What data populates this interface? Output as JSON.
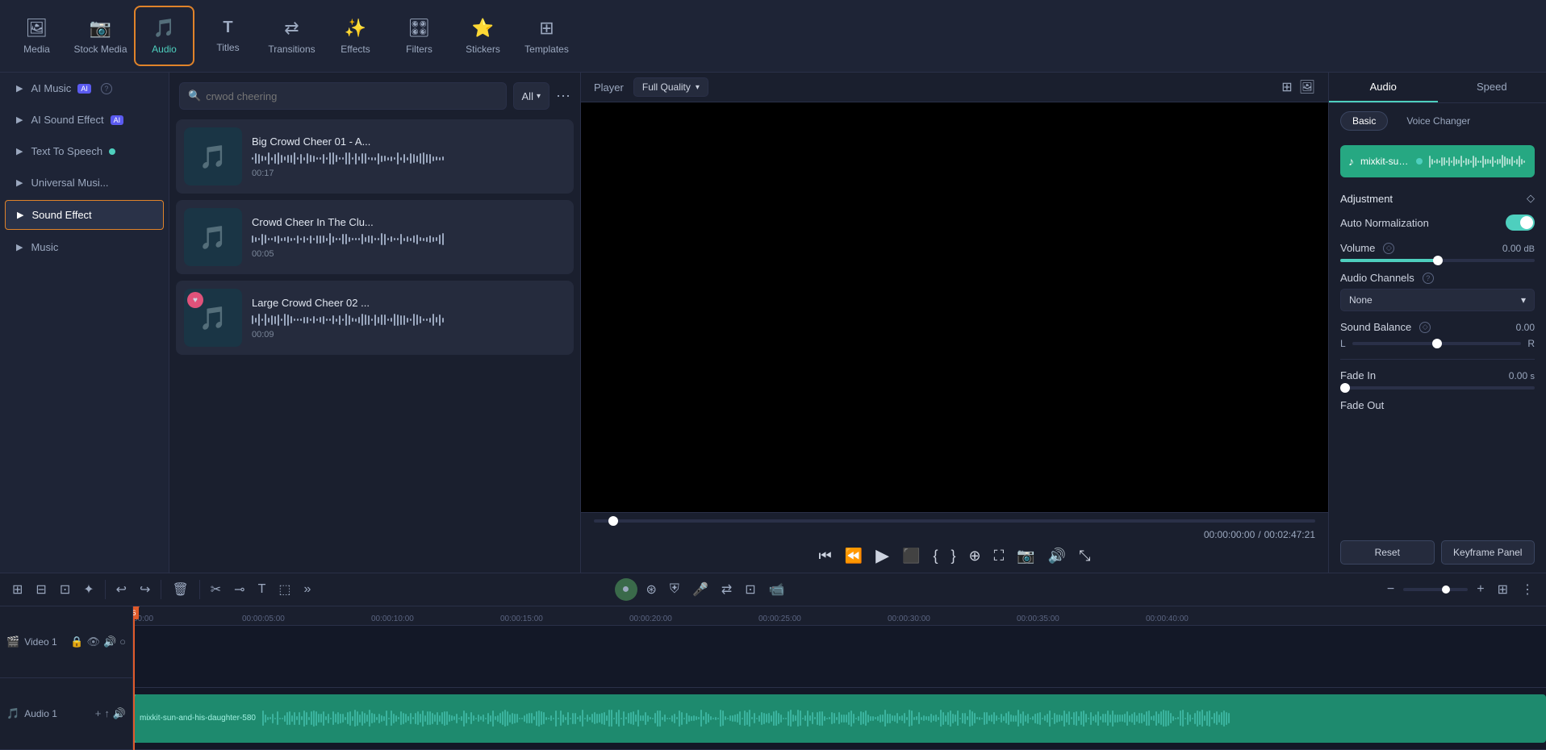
{
  "toolbar": {
    "items": [
      {
        "id": "media",
        "label": "Media",
        "icon": "🖼",
        "active": false
      },
      {
        "id": "stock-media",
        "label": "Stock Media",
        "icon": "📷",
        "active": false
      },
      {
        "id": "audio",
        "label": "Audio",
        "icon": "🎵",
        "active": true
      },
      {
        "id": "titles",
        "label": "Titles",
        "icon": "T",
        "active": false
      },
      {
        "id": "transitions",
        "label": "Transitions",
        "icon": "↔",
        "active": false
      },
      {
        "id": "effects",
        "label": "Effects",
        "icon": "✨",
        "active": false
      },
      {
        "id": "filters",
        "label": "Filters",
        "icon": "🎛",
        "active": false
      },
      {
        "id": "stickers",
        "label": "Stickers",
        "icon": "⭐",
        "active": false
      },
      {
        "id": "templates",
        "label": "Templates",
        "icon": "⊞",
        "active": false
      }
    ]
  },
  "left_panel": {
    "items": [
      {
        "id": "ai-music",
        "label": "AI Music",
        "has_ai_badge": true,
        "has_info": true
      },
      {
        "id": "ai-sound-effect",
        "label": "AI Sound Effect",
        "has_ai_badge": true
      },
      {
        "id": "text-to-speech",
        "label": "Text To Speech",
        "has_dot_badge": true
      },
      {
        "id": "universal-music",
        "label": "Universal Musi...",
        "has_nothing": true
      },
      {
        "id": "sound-effect",
        "label": "Sound Effect",
        "selected": true
      },
      {
        "id": "music",
        "label": "Music"
      }
    ]
  },
  "search": {
    "placeholder": "crwod cheering",
    "filter_label": "All"
  },
  "results": [
    {
      "id": "result-1",
      "title": "Big Crowd Cheer 01 - A...",
      "duration": "00:17",
      "thumb_color": "#1a3545"
    },
    {
      "id": "result-2",
      "title": "Crowd Cheer In The Clu...",
      "duration": "00:05",
      "thumb_color": "#1a3545"
    },
    {
      "id": "result-3",
      "title": "Large Crowd Cheer 02 ...",
      "duration": "00:09",
      "thumb_color": "#1a3545",
      "has_heart": true
    }
  ],
  "player": {
    "label": "Player",
    "quality": "Full Quality",
    "time_current": "00:00:00:00",
    "time_total": "00:02:47:21"
  },
  "right_panel": {
    "tabs": [
      "Audio",
      "Speed"
    ],
    "active_tab": "Audio",
    "sub_tabs": [
      "Basic",
      "Voice Changer"
    ],
    "active_sub_tab": "Basic",
    "audio_track_name": "mixkit-sun-and-his-d...",
    "adjustment_label": "Adjustment",
    "auto_normalization_label": "Auto Normalization",
    "auto_normalization_on": true,
    "volume_label": "Volume",
    "volume_value": "0.00",
    "volume_unit": "dB",
    "audio_channels_label": "Audio Channels",
    "channels_value": "None",
    "sound_balance_label": "Sound Balance",
    "balance_l": "L",
    "balance_r": "R",
    "balance_value": "0.00",
    "fade_in_label": "Fade In",
    "fade_in_value": "0.00",
    "fade_in_unit": "s",
    "fade_out_label": "Fade Out",
    "reset_label": "Reset",
    "keyframe_label": "Keyframe Panel"
  },
  "timeline": {
    "video_track_label": "Video 1",
    "audio_track_label": "Audio 1",
    "audio_clip_name": "mixkit-sun-and-his-daughter-580",
    "ruler_marks": [
      "00:00",
      "00:00:05:00",
      "00:00:10:00",
      "00:00:15:00",
      "00:00:20:00",
      "00:00:25:00",
      "00:00:30:00",
      "00:00:35:00",
      "00:00:40:00"
    ]
  }
}
